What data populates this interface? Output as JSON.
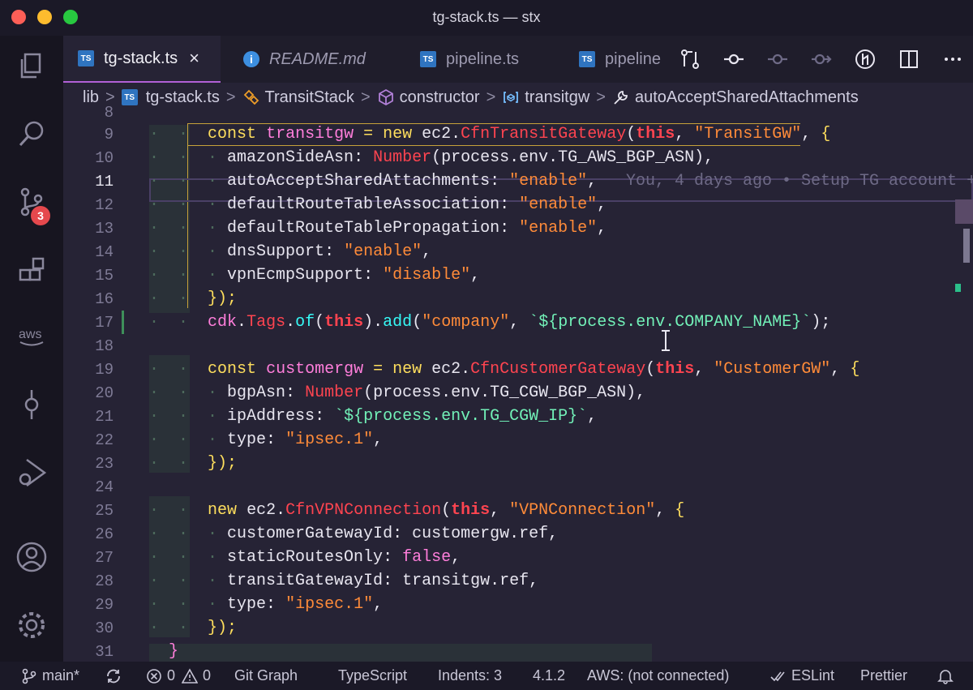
{
  "window": {
    "title": "tg-stack.ts — stx"
  },
  "activity": {
    "scm_badge": "3"
  },
  "tabs": [
    {
      "label": "tg-stack.ts",
      "icon": "TS",
      "close": "×"
    },
    {
      "label": "README.md",
      "icon": "i"
    },
    {
      "label": "pipeline.ts",
      "icon": "TS"
    },
    {
      "label": "pipeline",
      "icon": "TS"
    }
  ],
  "breadcrumb": {
    "folder": "lib",
    "file": "tg-stack.ts",
    "file_icon": "TS",
    "class": "TransitStack",
    "method": "constructor",
    "variable": "transitgw",
    "property": "autoAcceptSharedAttachments",
    "separator": ">"
  },
  "editor": {
    "blame": "You, 4 days ago • Setup TG account +",
    "lines": [
      {
        "n": "8"
      },
      {
        "n": "9"
      },
      {
        "n": "10"
      },
      {
        "n": "11"
      },
      {
        "n": "12"
      },
      {
        "n": "13"
      },
      {
        "n": "14"
      },
      {
        "n": "15"
      },
      {
        "n": "16"
      },
      {
        "n": "17"
      },
      {
        "n": "18"
      },
      {
        "n": "19"
      },
      {
        "n": "20"
      },
      {
        "n": "21"
      },
      {
        "n": "22"
      },
      {
        "n": "23"
      },
      {
        "n": "24"
      },
      {
        "n": "25"
      },
      {
        "n": "26"
      },
      {
        "n": "27"
      },
      {
        "n": "28"
      },
      {
        "n": "29"
      },
      {
        "n": "30"
      },
      {
        "n": "31"
      }
    ],
    "tokens": {
      "const": "const",
      "new": "new",
      "this": "this",
      "transitgw": "transitgw",
      "customergw": "customergw",
      "ec2": "ec2",
      "dot": ".",
      "CfnTransitGateway": "CfnTransitGateway",
      "CfnCustomerGateway": "CfnCustomerGateway",
      "CfnVPNConnection": "CfnVPNConnection",
      "Number": "Number",
      "cdk": "cdk",
      "Tags": "Tags",
      "of": "of",
      "add": "add",
      "eq": " = ",
      "openp": "(",
      "comma": ", ",
      "s_TransitGW": "\"TransitGW\"",
      "s_CustomerGW": "\"CustomerGW\"",
      "s_VPNConnection": "\"VPNConnection\"",
      "s_enable": "\"enable\"",
      "s_disable": "\"disable\"",
      "s_company": "\"company\"",
      "s_ipsec": "\"ipsec.1\"",
      "amazonSideAsn": "amazonSideAsn",
      "autoAccept": "autoAcceptSharedAttachments",
      "defaultAssoc": "defaultRouteTableAssociation",
      "defaultProp": "defaultRouteTablePropagation",
      "dnsSupport": "dnsSupport",
      "vpnEcmpSupport": "vpnEcmpSupport",
      "bgpAsn": "bgpAsn",
      "ipAddress": "ipAddress",
      "type": "type",
      "customerGatewayId": "customerGatewayId",
      "staticRoutesOnly": "staticRoutesOnly",
      "transitGatewayId": "transitGatewayId",
      "false": "false",
      "env_TG_AWS_BGP_ASN": "(process.env.TG_AWS_BGP_ASN),",
      "env_TG_CGW_BGP_ASN": "(process.env.TG_CGW_BGP_ASN),",
      "tpl_company": "`${process.env.COMPANY_NAME}`",
      "tpl_ip": "`${process.env.TG_CGW_IP}`",
      "close_obj": "});",
      "close_brace": "}",
      "open_brace": "{",
      "colon": ": ",
      "comma_end": ",",
      "customergw_ref": "customergw.ref,",
      "transitgw_ref": "transitgw.ref,",
      "tags_end": ");",
      "this_close": ")",
      "dots2": "·  ·",
      "dots3": "·  ·  ·",
      "dots5": "·  ·  ·  ·  ·"
    }
  },
  "statusbar": {
    "branch": "main*",
    "errors": "0",
    "warnings": "0",
    "git_graph": "Git Graph",
    "language": "TypeScript",
    "indents": "Indents: 3",
    "version": "4.1.2",
    "aws": "AWS: (not connected)",
    "eslint": "ESLint",
    "prettier": "Prettier"
  },
  "colors": {
    "background": "#262335",
    "keyword": "#fede5d",
    "string": "#ff8b39",
    "identifier": "#ff7edb",
    "class": "#fe4450",
    "function": "#36f9f6",
    "template": "#72f1b8",
    "accent": "#b160d6",
    "badge": "#e5484d"
  }
}
